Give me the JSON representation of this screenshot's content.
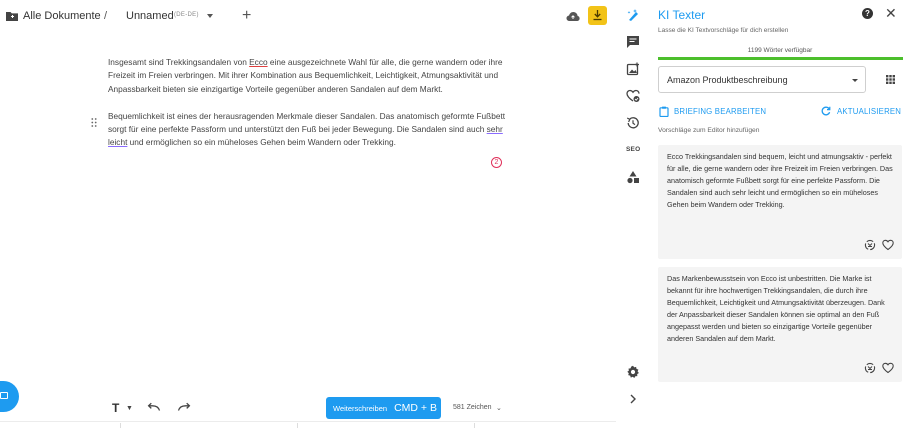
{
  "header": {
    "breadcrumb_root": "Alle Dokumente",
    "separator": "/",
    "document_name": "Unnamed",
    "document_lang": "(DE-DE)"
  },
  "editor": {
    "paragraph_1": [
      "Insgesamt sind Trekkingsandalen von ",
      "Ecco",
      " eine ausgezeichnete Wahl für alle, die gerne wandern oder ihre Freizeit im Freien verbringen. Mit ihrer Kombination aus Bequemlichkeit, Leichtigkeit, Atmungsaktivität und Anpassbarkeit bieten sie einzigartige Vorteile gegenüber anderen Sandalen auf dem Markt."
    ],
    "paragraph_2": [
      "Bequemlichkeit ist eines der herausragenden Merkmale dieser Sandalen. Das anatomisch geformte Fußbett sorgt für eine perfekte Passform und unterstützt den Fuß bei jeder Bewegung. Die Sandalen sind auch ",
      "sehr leicht",
      " und ermöglichen so ein müheloses Gehen beim Wandern oder Trekking."
    ],
    "issue_badge": "2"
  },
  "toolbar": {
    "text_format": "T",
    "continue_label": "Weiterschreiben",
    "continue_shortcut": "CMD + B",
    "char_count": "581 Zeichen"
  },
  "rail": {
    "seo_label": "SEO"
  },
  "panel": {
    "title": "KI Texter",
    "subtitle": "Lasse die KI Textvorschläge für dich erstellen",
    "words_left": "1199 Wörter verfügbar",
    "progress": 1.0,
    "template": "Amazon Produktbeschreibung",
    "briefing_label": "BRIEFING BEARBEITEN",
    "refresh_label": "AKTUALISIEREN",
    "hint": "Vorschläge zum Editor hinzufügen",
    "suggestions": [
      "Ecco Trekkingsandalen sind bequem, leicht und atmungsaktiv - perfekt für alle, die gerne wandern oder ihre Freizeit im Freien verbringen. Das anatomisch geformte Fußbett sorgt für eine perfekte Passform. Die Sandalen sind auch sehr leicht und ermöglichen so ein müheloses Gehen beim Wandern oder Trekking.",
      "Das Markenbewusstsein von Ecco ist unbestritten. Die Marke ist bekannt für ihre hochwertigen Trekkingsandalen, die durch ihre Bequemlichkeit, Leichtigkeit und Atmungsaktivität überzeugen. Dank der Anpassbarkeit dieser Sandalen können sie optimal an den Fuß angepasst werden und bieten so einzigartige Vorteile gegenüber anderen Sandalen auf dem Markt."
    ]
  },
  "colors": {
    "accent": "#1e9bf0",
    "download": "#f2c318",
    "progress": "#4cbf2c",
    "error": "#e0305a"
  }
}
